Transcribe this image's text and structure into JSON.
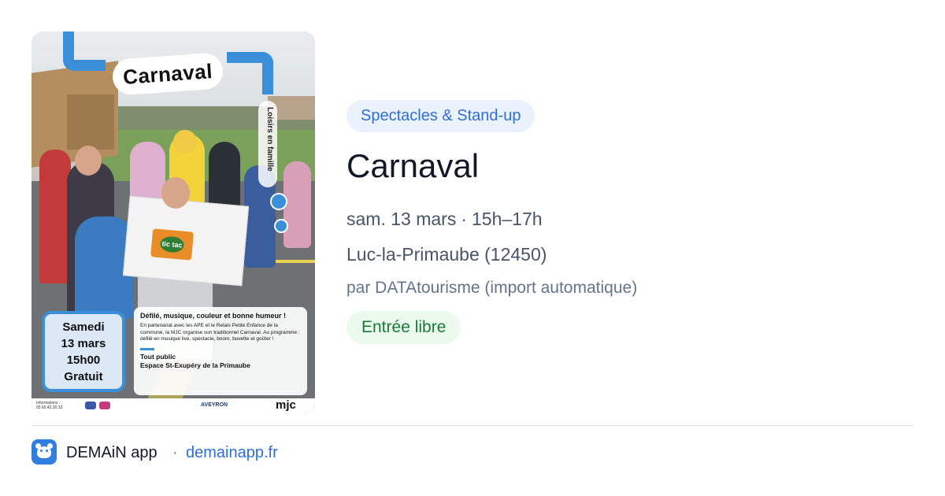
{
  "poster": {
    "title": "Carnaval",
    "vertical_tag": "Loisirs en famille",
    "date_lines": [
      "Samedi",
      "13 mars",
      "15h00",
      "Gratuit"
    ],
    "headline": "Défilé, musique, couleur et bonne humeur !",
    "body": "En partenariat avec les APE et le Relais Petite Enfance de la commune, la MJC organise son traditionnel Carnaval. Au programme : défilé en musique live, spectacle, boom, buvette et goûter !",
    "audience": "Tout public",
    "venue": "Espace St-Exupéry de la Primaube",
    "info_label": "Informations :",
    "info_phone": "05.65.42.30.33",
    "box_logo_text": "tic tac",
    "partner_aveyron": "AVEYRON",
    "partner_mjc": "mjc"
  },
  "event": {
    "category": "Spectacles & Stand-up",
    "title": "Carnaval",
    "date": "sam. 13 mars",
    "separator": "·",
    "time": "15h–17h",
    "location": "Luc-la-Primaube (12450)",
    "source": "par DATAtourisme (import automatique)",
    "price": "Entrée libre"
  },
  "footer": {
    "app_name": "DEMAiN app",
    "separator": "·",
    "domain": "demainapp.fr"
  },
  "colors": {
    "badge_bg": "#eaf2fd",
    "badge_text": "#2f6fd4",
    "price_bg": "#ecfaee",
    "price_text": "#167a39",
    "poster_accent": "#3b8fd8"
  }
}
